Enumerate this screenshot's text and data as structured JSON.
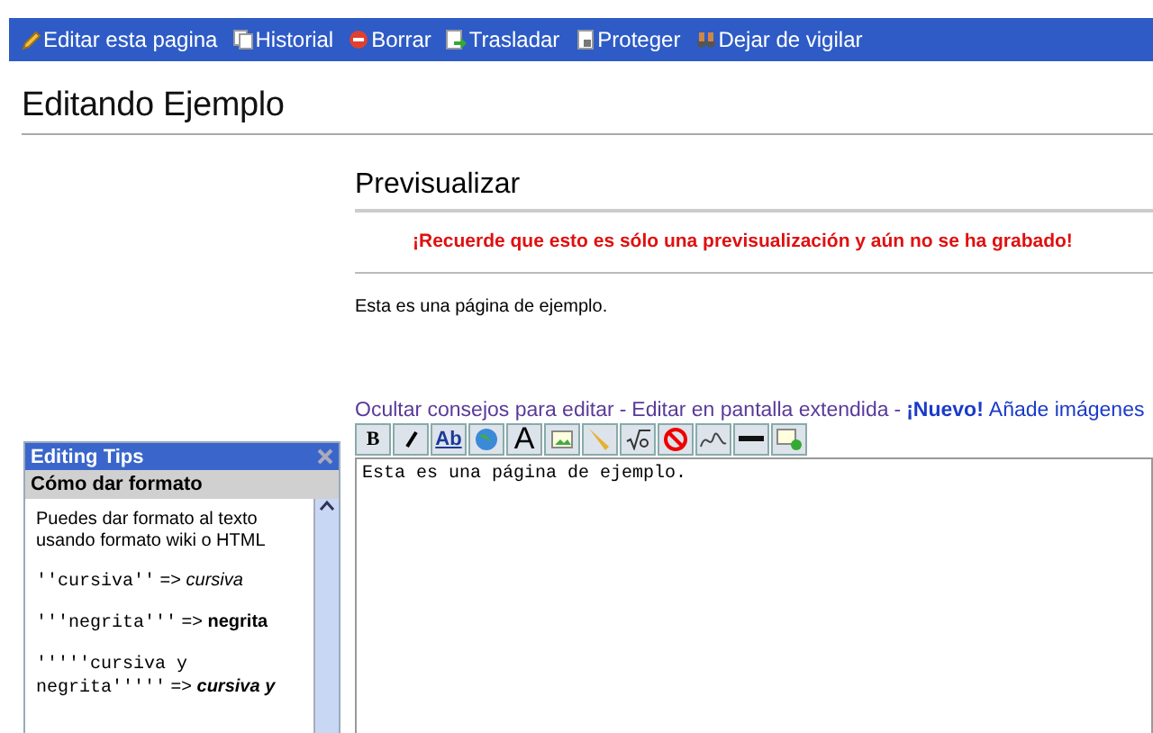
{
  "nav": [
    {
      "label": "Editar esta pagina"
    },
    {
      "label": "Historial"
    },
    {
      "label": "Borrar"
    },
    {
      "label": "Trasladar"
    },
    {
      "label": "Proteger"
    },
    {
      "label": "Dejar de vigilar"
    }
  ],
  "title": "Editando Ejemplo",
  "preview": {
    "heading": "Previsualizar",
    "warning": "¡Recuerde que esto es sólo una previsualización y aún no se ha grabado!",
    "body": "Esta es una página de ejemplo."
  },
  "tips": {
    "title": "Editing Tips",
    "subtitle": "Cómo dar formato",
    "items": [
      {
        "kind": "text",
        "text": "Puedes dar formato al texto usando formato wiki o HTML"
      },
      {
        "kind": "italic",
        "code": "''cursiva''",
        "arrow": "=>",
        "result": "cursiva"
      },
      {
        "kind": "bold",
        "code": "'''negrita'''",
        "arrow": "=>",
        "result": "negrita"
      },
      {
        "kind": "bold-italic",
        "code": "'''''cursiva y negrita'''''",
        "arrow": "=>",
        "result": "cursiva y"
      }
    ]
  },
  "links": [
    {
      "kind": "link",
      "text": "Ocultar consejos para editar"
    },
    {
      "kind": "sep",
      "text": "-"
    },
    {
      "kind": "link",
      "text": "Editar en pantalla extendida"
    },
    {
      "kind": "sep",
      "text": "-"
    },
    {
      "kind": "new",
      "text": "¡Nuevo!"
    },
    {
      "kind": "link2",
      "text": "Añade imágenes"
    }
  ],
  "toolbar": [
    {
      "kind": "bold",
      "label": "B"
    },
    {
      "kind": "italic"
    },
    {
      "kind": "link",
      "label": "Ab"
    },
    {
      "kind": "globe"
    },
    {
      "kind": "heading",
      "label": "A"
    },
    {
      "kind": "image"
    },
    {
      "kind": "media"
    },
    {
      "kind": "math"
    },
    {
      "kind": "nowiki"
    },
    {
      "kind": "signature"
    },
    {
      "kind": "rule"
    },
    {
      "kind": "gallery"
    }
  ],
  "editor": {
    "value": "Esta es una página de ejemplo."
  }
}
